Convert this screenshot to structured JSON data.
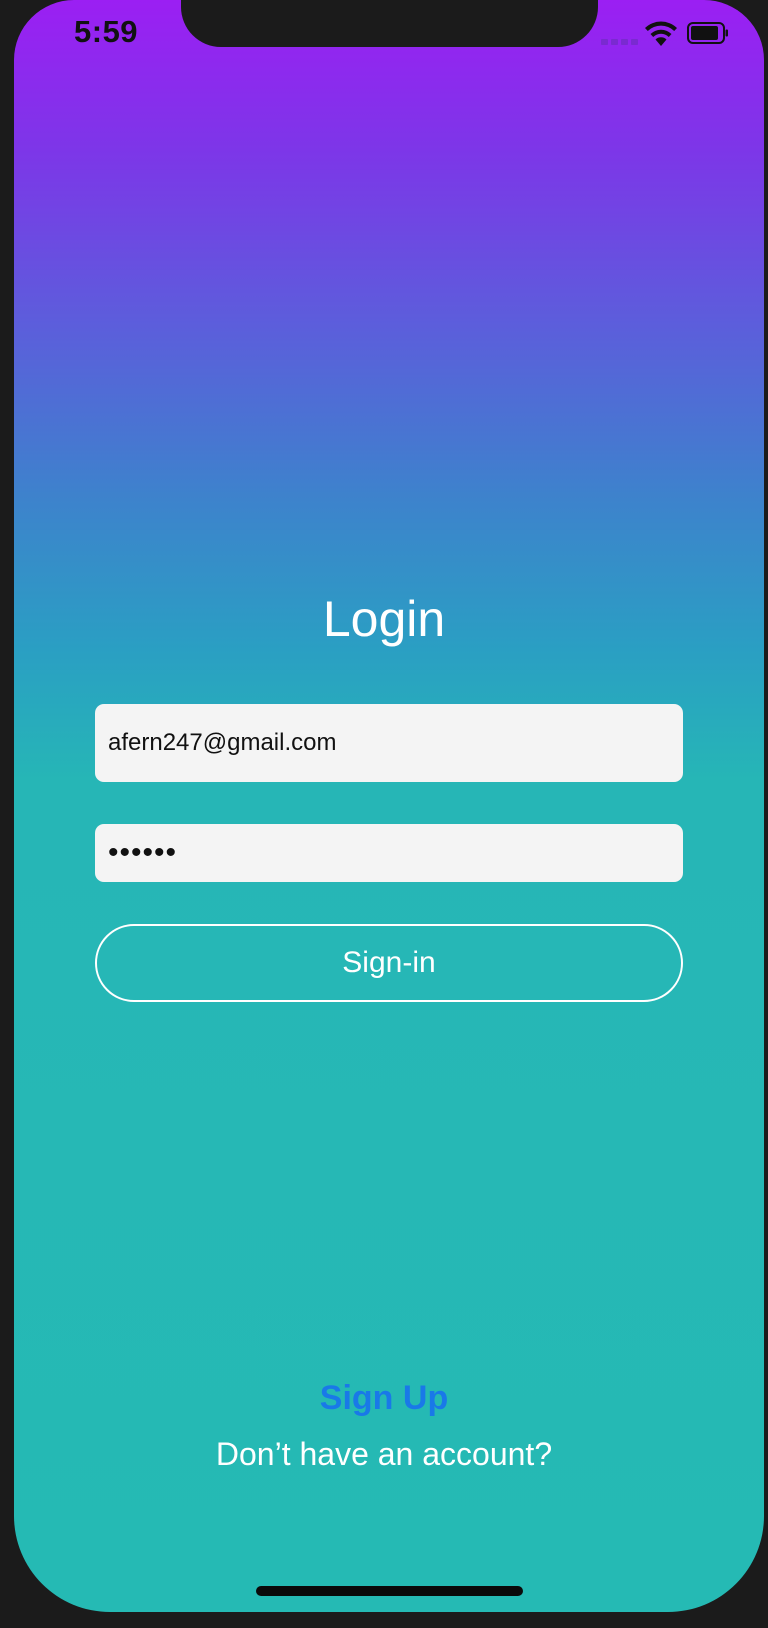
{
  "status_bar": {
    "time": "5:59"
  },
  "login": {
    "title": "Login",
    "email_value": "afern247@gmail.com",
    "password_value": "••••••",
    "signin_label": "Sign-in"
  },
  "footer": {
    "signup_label": "Sign Up",
    "no_account_text": "Don’t have an account?"
  },
  "colors": {
    "gradient_top": "#9b1ff3",
    "gradient_bottom": "#25bab4",
    "link": "#1979e8",
    "input_bg": "#f4f4f4"
  },
  "icons": [
    "wifi-icon",
    "battery-icon",
    "signal-icon"
  ]
}
